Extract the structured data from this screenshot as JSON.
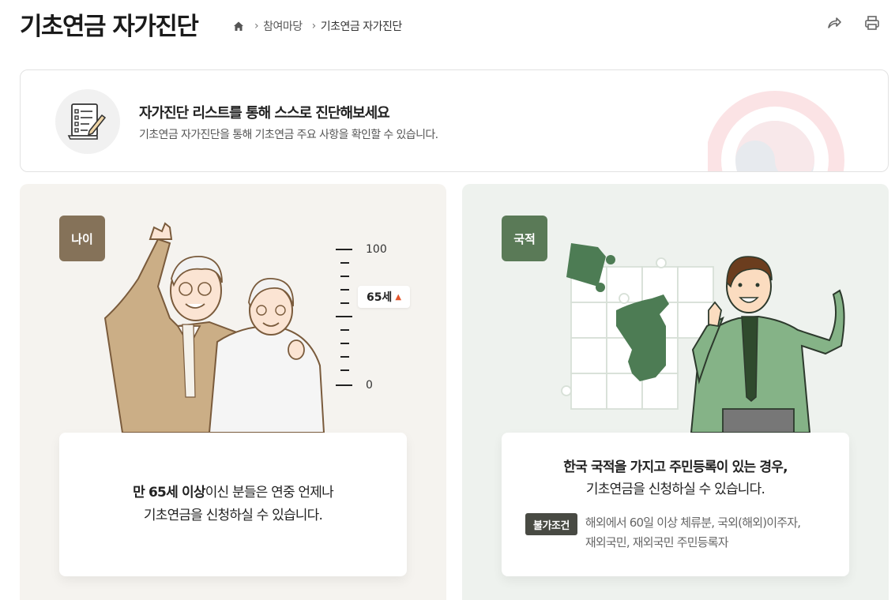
{
  "header": {
    "title": "기초연금 자가진단",
    "breadcrumb": [
      {
        "label": "참여마당"
      },
      {
        "label": "기초연금 자가진단"
      }
    ],
    "actions": [
      {
        "icon": "share-icon"
      },
      {
        "icon": "print-icon"
      }
    ]
  },
  "intro": {
    "icon": "checklist-icon",
    "title": "자가진단 리스트를 통해 스스로 진단해보세요",
    "description": "기초연금 자가진단을 통해 기초연금 주요 사항을 확인할 수 있습니다."
  },
  "age_card": {
    "badge": "나이",
    "ruler": {
      "max_label": "100",
      "min_label": "0",
      "marker_label": "65세"
    },
    "text_bold": "만 65세 이상",
    "text_rest_1": "이신 분들은 연중 언제나",
    "text_line_2": "기초연금을 신청하실 수 있습니다."
  },
  "nationality_card": {
    "badge": "국적",
    "text_line_1": "한국 국적을 가지고 주민등록이 있는 경우,",
    "text_line_2": "기초연금을 신청하실 수 있습니다.",
    "condition_tag": "불가조건",
    "condition_line_1": "해외에서 60일 이상 체류분, 국외(해외)이주자,",
    "condition_line_2": "재외국민, 재외국민 주민등록자"
  },
  "colors": {
    "age_card_bg": "#f5f3ef",
    "nat_card_bg": "#eef2ee",
    "age_badge": "#857259",
    "nat_badge": "#5a7a57",
    "marker_arrow": "#e4572e"
  }
}
